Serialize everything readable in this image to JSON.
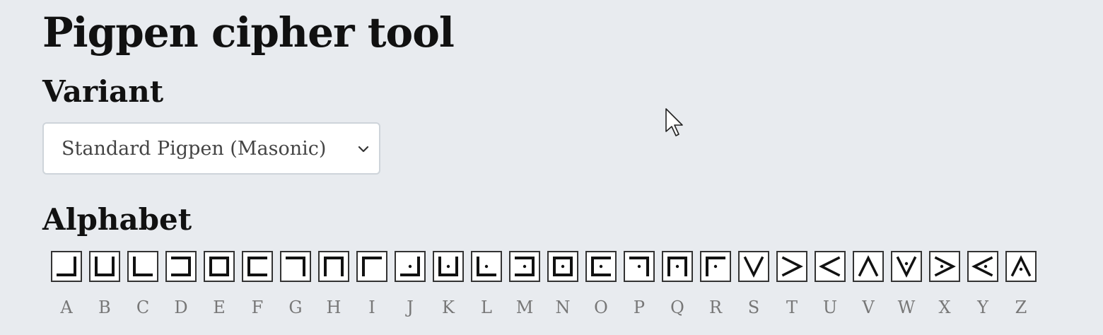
{
  "page": {
    "title": "Pigpen cipher tool"
  },
  "variant": {
    "heading": "Variant",
    "selected": "Standard Pigpen (Masonic)"
  },
  "alphabet": {
    "heading": "Alphabet",
    "letters": [
      {
        "letter": "A",
        "glyph": "grid-corner-top-left"
      },
      {
        "letter": "B",
        "glyph": "grid-top-middle"
      },
      {
        "letter": "C",
        "glyph": "grid-corner-top-right"
      },
      {
        "letter": "D",
        "glyph": "grid-middle-left"
      },
      {
        "letter": "E",
        "glyph": "grid-center"
      },
      {
        "letter": "F",
        "glyph": "grid-middle-right"
      },
      {
        "letter": "G",
        "glyph": "grid-corner-bottom-left"
      },
      {
        "letter": "H",
        "glyph": "grid-bottom-middle"
      },
      {
        "letter": "I",
        "glyph": "grid-corner-bottom-right"
      },
      {
        "letter": "J",
        "glyph": "dotted-grid-corner-top-left"
      },
      {
        "letter": "K",
        "glyph": "dotted-grid-top-middle"
      },
      {
        "letter": "L",
        "glyph": "dotted-grid-corner-top-right"
      },
      {
        "letter": "M",
        "glyph": "dotted-grid-middle-left"
      },
      {
        "letter": "N",
        "glyph": "dotted-grid-center"
      },
      {
        "letter": "O",
        "glyph": "dotted-grid-middle-right"
      },
      {
        "letter": "P",
        "glyph": "dotted-grid-corner-bottom-left"
      },
      {
        "letter": "Q",
        "glyph": "dotted-grid-bottom-middle"
      },
      {
        "letter": "R",
        "glyph": "dotted-grid-corner-bottom-right"
      },
      {
        "letter": "S",
        "glyph": "x-top"
      },
      {
        "letter": "T",
        "glyph": "x-left"
      },
      {
        "letter": "U",
        "glyph": "x-right"
      },
      {
        "letter": "V",
        "glyph": "x-bottom"
      },
      {
        "letter": "W",
        "glyph": "dotted-x-top"
      },
      {
        "letter": "X",
        "glyph": "dotted-x-left"
      },
      {
        "letter": "Y",
        "glyph": "dotted-x-right"
      },
      {
        "letter": "Z",
        "glyph": "dotted-x-bottom"
      }
    ]
  }
}
